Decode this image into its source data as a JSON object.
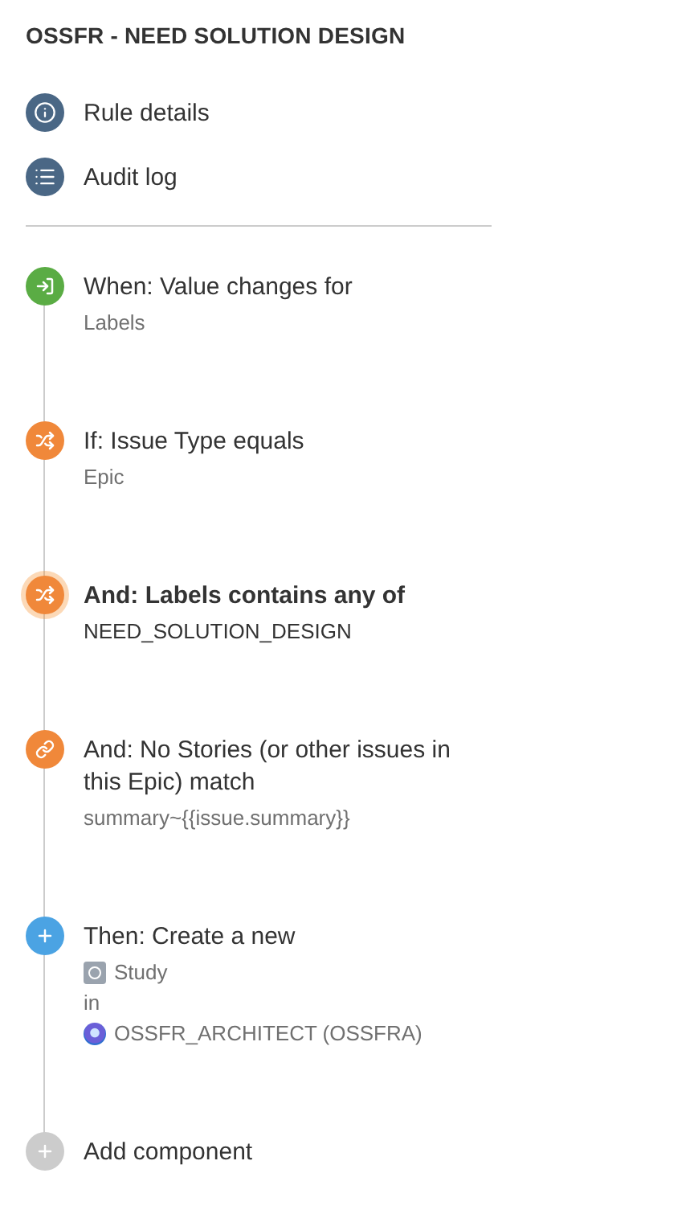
{
  "title": "OSSFR - NEED SOLUTION DESIGN",
  "nav": [
    {
      "kind": "info",
      "label": "Rule details"
    },
    {
      "kind": "log",
      "label": "Audit log"
    }
  ],
  "steps": [
    {
      "kind": "trigger",
      "selected": false,
      "title": "When: Value changes for",
      "details": [
        {
          "kind": "text",
          "text": "Labels"
        }
      ]
    },
    {
      "kind": "condition",
      "selected": false,
      "title": "If: Issue Type equals",
      "details": [
        {
          "kind": "text",
          "text": "Epic"
        }
      ]
    },
    {
      "kind": "condition",
      "selected": true,
      "title": "And: Labels contains any of",
      "details": [
        {
          "kind": "text",
          "text": "NEED_SOLUTION_DESIGN"
        }
      ]
    },
    {
      "kind": "related",
      "selected": false,
      "title": "And: No Stories (or other issues in this Epic) match",
      "details": [
        {
          "kind": "text",
          "text": "summary~{{issue.summary}}"
        }
      ]
    },
    {
      "kind": "action",
      "selected": false,
      "title": "Then: Create a new",
      "details": [
        {
          "kind": "issue-type",
          "text": "Study"
        },
        {
          "kind": "text",
          "text": "in"
        },
        {
          "kind": "project",
          "text": "OSSFR_ARCHITECT (OSSFRA)"
        }
      ]
    },
    {
      "kind": "add",
      "selected": false,
      "title": "Add component"
    }
  ]
}
